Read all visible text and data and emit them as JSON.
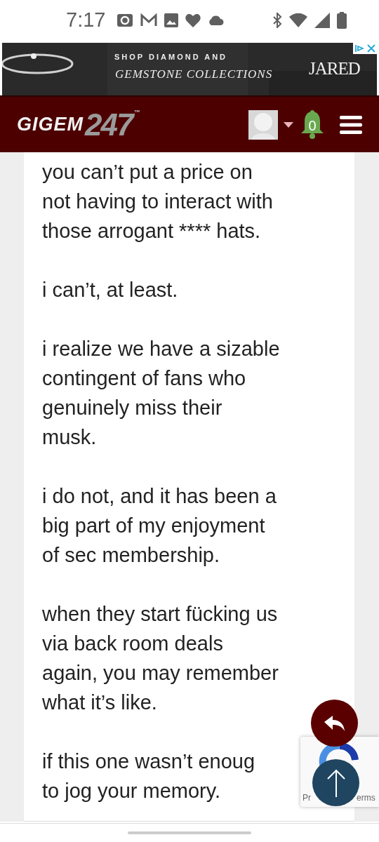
{
  "status_bar": {
    "time": "7:17"
  },
  "ad": {
    "line_1": "SHOP DIAMOND AND",
    "line_2": "GEMSTONE COLLECTIONS",
    "brand": "JARED"
  },
  "header": {
    "logo_word": "GIGEM",
    "logo_number": "247",
    "logo_mark": "™",
    "notification_count": "0"
  },
  "post": {
    "paragraphs": [
      {
        "lines": [
          "you can’t put a price on",
          "not having to interact with",
          "those arrogant **** hats."
        ]
      },
      {
        "lines": [
          "i can’t, at least."
        ]
      },
      {
        "lines": [
          "i realize we have a sizable",
          "contingent of fans who",
          "genuinely miss their",
          "musk."
        ]
      },
      {
        "lines": [
          "i do not, and it has been a",
          "big part of my enjoyment",
          "of sec membership."
        ]
      },
      {
        "lines": [
          "when they start fücking us",
          "via back room deals",
          "again, you may remember",
          "what it’s like."
        ]
      },
      {
        "lines": [
          "if this one wasn’t enoug",
          "to jog your memory."
        ]
      }
    ]
  },
  "recaptcha": {
    "text_left": "Pr",
    "text_right": "erms"
  }
}
